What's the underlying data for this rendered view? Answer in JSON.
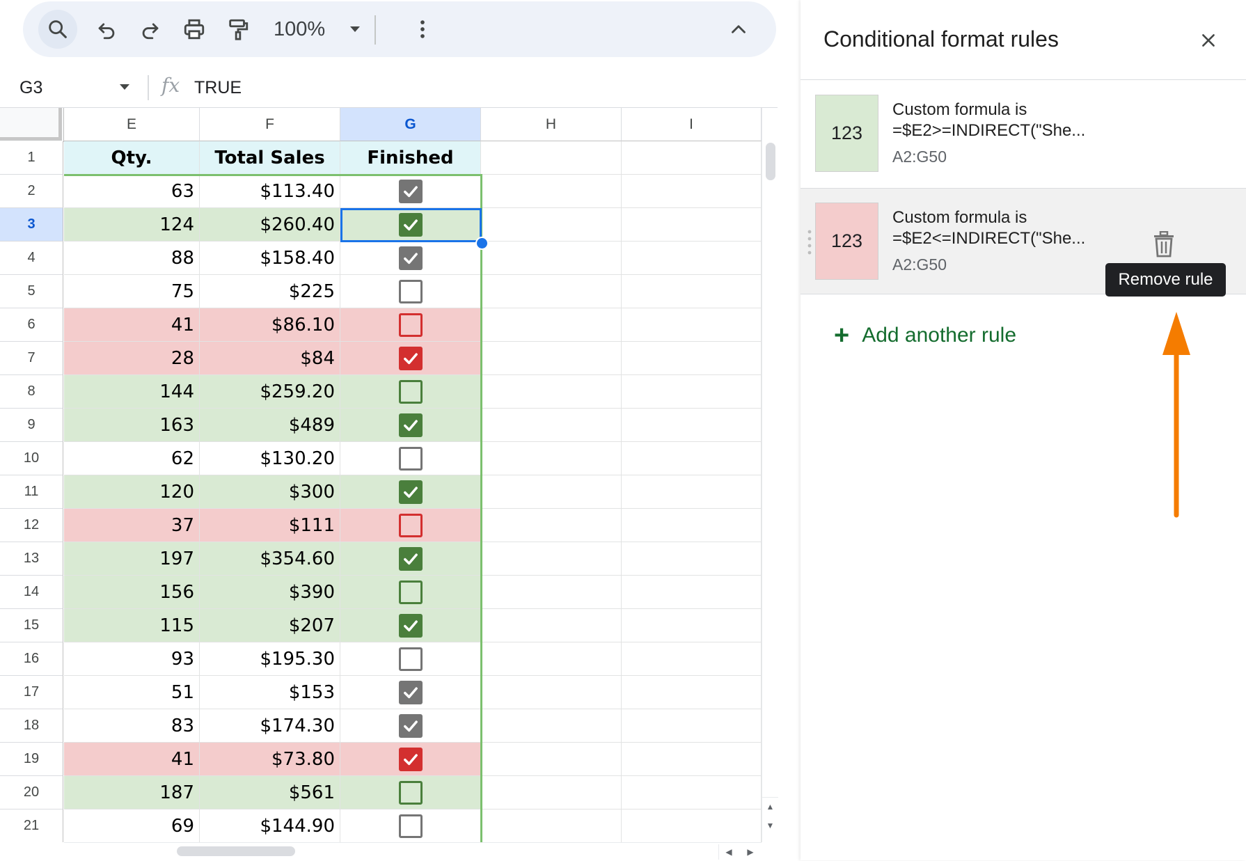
{
  "toolbar": {
    "zoom": "100%"
  },
  "formula_bar": {
    "name_box": "G3",
    "fx": "fx",
    "value": "TRUE"
  },
  "grid": {
    "columns": [
      "E",
      "F",
      "G",
      "H",
      "I"
    ],
    "selected_column": "G",
    "selected_row": "3",
    "header_row": {
      "row": "1",
      "qty": "Qty.",
      "total": "Total Sales",
      "finished": "Finished"
    },
    "rows": [
      {
        "row": "2",
        "qty": "63",
        "total": "$113.40",
        "checked": true,
        "fmt": "none"
      },
      {
        "row": "3",
        "qty": "124",
        "total": "$260.40",
        "checked": true,
        "fmt": "green"
      },
      {
        "row": "4",
        "qty": "88",
        "total": "$158.40",
        "checked": true,
        "fmt": "none"
      },
      {
        "row": "5",
        "qty": "75",
        "total": "$225",
        "checked": false,
        "fmt": "none"
      },
      {
        "row": "6",
        "qty": "41",
        "total": "$86.10",
        "checked": false,
        "fmt": "red"
      },
      {
        "row": "7",
        "qty": "28",
        "total": "$84",
        "checked": true,
        "fmt": "red"
      },
      {
        "row": "8",
        "qty": "144",
        "total": "$259.20",
        "checked": false,
        "fmt": "green"
      },
      {
        "row": "9",
        "qty": "163",
        "total": "$489",
        "checked": true,
        "fmt": "green"
      },
      {
        "row": "10",
        "qty": "62",
        "total": "$130.20",
        "checked": false,
        "fmt": "none"
      },
      {
        "row": "11",
        "qty": "120",
        "total": "$300",
        "checked": true,
        "fmt": "green"
      },
      {
        "row": "12",
        "qty": "37",
        "total": "$111",
        "checked": false,
        "fmt": "red"
      },
      {
        "row": "13",
        "qty": "197",
        "total": "$354.60",
        "checked": true,
        "fmt": "green"
      },
      {
        "row": "14",
        "qty": "156",
        "total": "$390",
        "checked": false,
        "fmt": "green"
      },
      {
        "row": "15",
        "qty": "115",
        "total": "$207",
        "checked": true,
        "fmt": "green"
      },
      {
        "row": "16",
        "qty": "93",
        "total": "$195.30",
        "checked": false,
        "fmt": "none"
      },
      {
        "row": "17",
        "qty": "51",
        "total": "$153",
        "checked": true,
        "fmt": "none"
      },
      {
        "row": "18",
        "qty": "83",
        "total": "$174.30",
        "checked": true,
        "fmt": "none"
      },
      {
        "row": "19",
        "qty": "41",
        "total": "$73.80",
        "checked": true,
        "fmt": "red"
      },
      {
        "row": "20",
        "qty": "187",
        "total": "$561",
        "checked": false,
        "fmt": "green"
      },
      {
        "row": "21",
        "qty": "69",
        "total": "$144.90",
        "checked": false,
        "fmt": "none"
      }
    ]
  },
  "colors": {
    "green_fill": "#d9ead3",
    "red_fill": "#f4cccc",
    "checkbox_gray": "#757575",
    "checkbox_green": "#4a7f3c",
    "checkbox_red": "#d32f2f",
    "selection": "#1a73e8",
    "add_rule_green": "#146c2e",
    "arrow_orange": "#f57c00"
  },
  "panel": {
    "title": "Conditional format rules",
    "rules": [
      {
        "preview": "123",
        "condition": "Custom formula is",
        "formula": "=$E2>=INDIRECT(\"She...",
        "range": "A2:G50",
        "color": "#d9ead3"
      },
      {
        "preview": "123",
        "condition": "Custom formula is",
        "formula": "=$E2<=INDIRECT(\"She...",
        "range": "A2:G50",
        "color": "#f4cccc"
      }
    ],
    "tooltip": "Remove rule",
    "add_rule": "Add another rule"
  }
}
